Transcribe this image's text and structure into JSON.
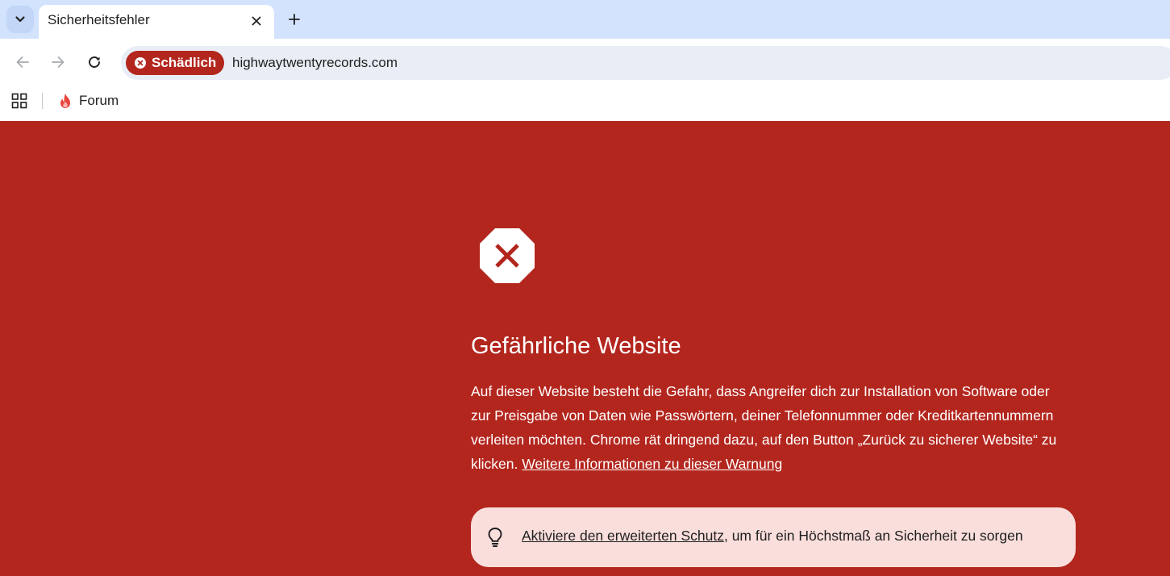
{
  "browser": {
    "tab": {
      "title": "Sicherheitsfehler"
    },
    "omnibox": {
      "security_chip": "Schädlich",
      "url": "highwaytwentyrecords.com"
    },
    "bookmarks": [
      {
        "label": "Forum",
        "icon": "flame-icon"
      }
    ]
  },
  "interstitial": {
    "heading": "Gefährliche Website",
    "body": "Auf dieser Website besteht die Gefahr, dass Angreifer dich zur Installation von Software oder zur Preisgabe von Daten wie Passwörtern, deiner Telefonnummer oder Kreditkartennummern verleiten möchten. Chrome rät dringend dazu, auf den Button „Zurück zu sicherer Website“ zu klicken.",
    "more_info_link": "Weitere Informationen zu dieser Warnung",
    "protection": {
      "link": "Aktiviere den erweiterten Schutz",
      "suffix": ", um für ein Höchstmaß an Sicherheit zu sorgen"
    }
  },
  "colors": {
    "danger_background": "#b3261e",
    "tabstrip": "#d3e3fd",
    "omnibox": "#e9eef6",
    "protection_box": "#f9dedc"
  }
}
